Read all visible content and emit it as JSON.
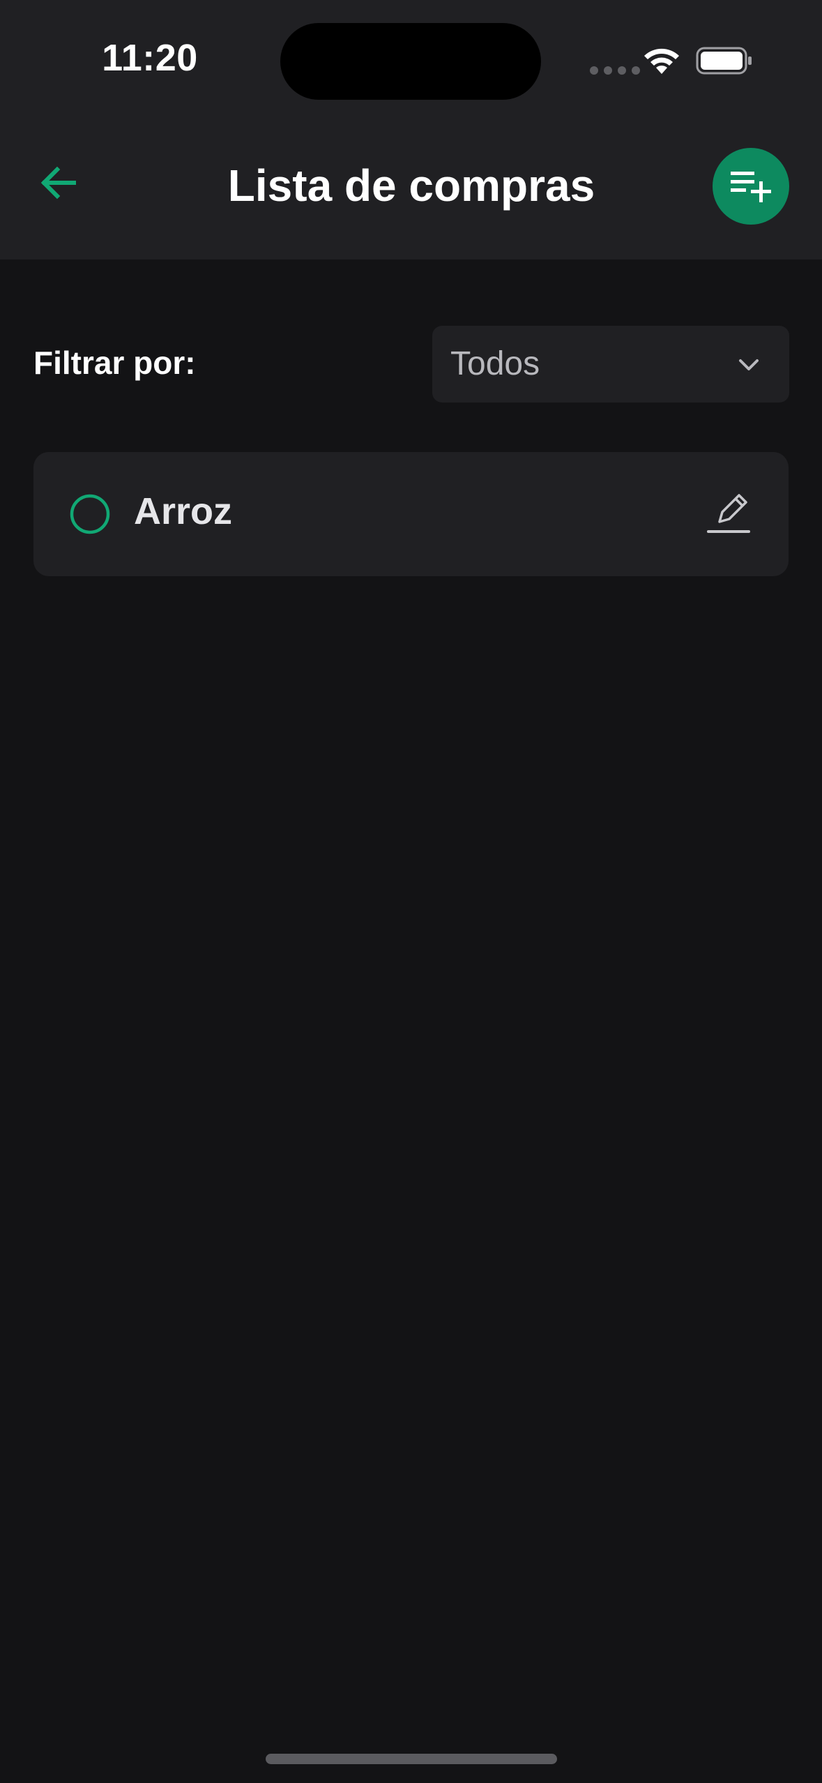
{
  "status_bar": {
    "time": "11:20"
  },
  "header": {
    "title": "Lista de compras",
    "back_icon": "arrow-left-icon",
    "add_icon": "playlist-add-icon"
  },
  "filter": {
    "label": "Filtrar por:",
    "selected": "Todos"
  },
  "items": [
    {
      "label": "Arroz",
      "checked": false
    }
  ],
  "colors": {
    "accent": "#0d8a5f",
    "accent_outline": "#11a874",
    "header_bg": "#202023",
    "page_bg": "#131315",
    "card_bg": "#202023",
    "text_primary": "#ffffff",
    "text_secondary": "#b8b8bd"
  }
}
